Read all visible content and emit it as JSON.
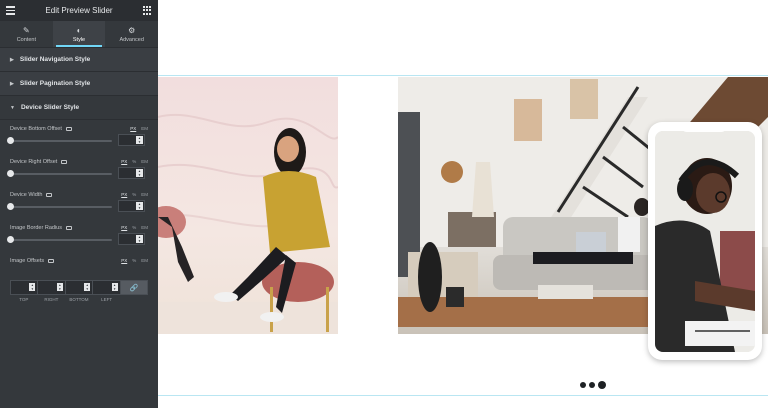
{
  "panel": {
    "title": "Edit Preview Slider",
    "icons": {
      "menu": "hamburger-icon",
      "apps": "grid-icon"
    },
    "tabs": [
      {
        "label": "Content",
        "icon": "pencil-icon"
      },
      {
        "label": "Style",
        "icon": "half-circle-icon"
      },
      {
        "label": "Advanced",
        "icon": "gear-icon"
      }
    ],
    "active_tab": "Style",
    "sections": {
      "nav": "Slider Navigation Style",
      "pagination": "Slider Pagination Style",
      "device": "Device Slider Style"
    },
    "controls": [
      {
        "label": "Device Bottom Offset",
        "units": [
          "PX",
          "EM"
        ],
        "unit_active": "PX",
        "value": 0.0
      },
      {
        "label": "Device Right Offset",
        "units": [
          "PX",
          "%",
          "EM"
        ],
        "unit_active": "PX",
        "value": 0.0
      },
      {
        "label": "Device Width",
        "units": [
          "PX",
          "%",
          "EM"
        ],
        "unit_active": "PX",
        "value": 0.0
      },
      {
        "label": "Image Border Radius",
        "units": [
          "PX",
          "%",
          "EM"
        ],
        "unit_active": "PX",
        "value": 0.0
      }
    ],
    "offsets": {
      "label": "Image Offsets",
      "units": [
        "PX",
        "%",
        "EM"
      ],
      "unit_active": "PX",
      "sides": [
        "TOP",
        "RIGHT",
        "BOTTOM",
        "LEFT"
      ],
      "link_icon": "link-icon"
    },
    "colors": {
      "panel": "#34383c",
      "accent": "#71d7f7"
    }
  },
  "preview": {
    "images": [
      "woman-in-yellow-jacket-photo",
      "living-room-photo"
    ],
    "device": "phone-mockup-man-with-headphones",
    "pagination": {
      "count": 3,
      "active": 3
    }
  }
}
